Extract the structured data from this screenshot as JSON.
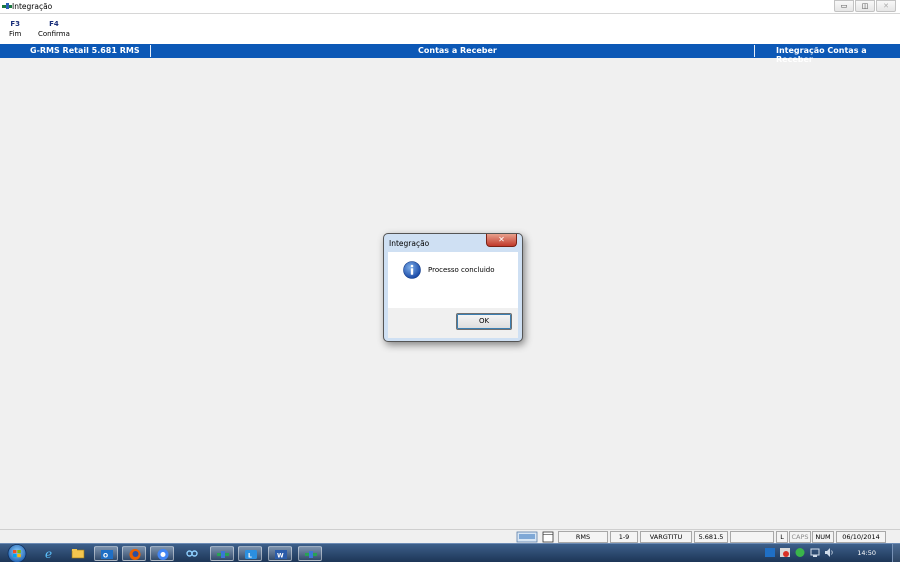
{
  "window": {
    "title": "Integração",
    "controls": {
      "minimize": "▭",
      "maximize": "◫",
      "close": "✕"
    }
  },
  "fkeys": [
    {
      "key": "F3",
      "label": "Fim"
    },
    {
      "key": "F4",
      "label": "Confirma"
    }
  ],
  "header": {
    "left": "G-RMS Retail 5.681 RMS",
    "center": "Contas a Receber",
    "right": "Integração Contas a Receber"
  },
  "dialog": {
    "title": "Integração",
    "close_glyph": "✕",
    "message": "Processo concluido",
    "ok_label": "OK",
    "icon": "info-icon"
  },
  "statusbar": {
    "cells": [
      "RMS",
      "1-9",
      "VARGTITU",
      "5.681.5",
      "",
      "L",
      "CAPS",
      "NUM",
      "06/10/2014"
    ]
  },
  "taskbar": {
    "clock": "14:50",
    "apps": [
      "start-orb",
      "ie-icon",
      "explorer-icon",
      "outlook-icon",
      "firefox-icon",
      "chrome-icon",
      "link-icon",
      "rms-icon",
      "lync-icon",
      "word-icon",
      "rms-active-icon"
    ]
  },
  "colors": {
    "header_blue": "#0c58b6",
    "dialog_frame": "#cfe0f3",
    "close_red": "#c0392b",
    "taskbar": "#1d3657"
  }
}
